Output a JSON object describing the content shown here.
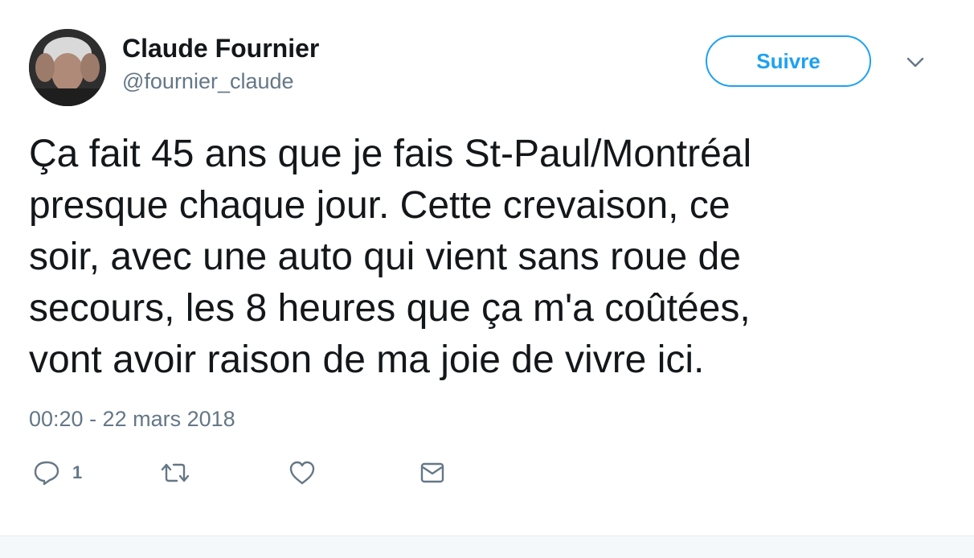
{
  "author": {
    "display_name": "Claude Fournier",
    "handle": "@fournier_claude",
    "avatar_icon": "user-photo-avatar"
  },
  "header": {
    "follow_label": "Suivre",
    "caret_icon": "chevron-down-icon"
  },
  "tweet": {
    "lines": [
      "Ça fait 45 ans que je fais St-Paul/Montréal",
      "presque chaque jour. Cette crevaison, ce",
      "soir, avec une auto qui vient sans roue de",
      "secours, les 8 heures que ça m'a coûtées,",
      "vont avoir raison de ma joie de vivre ici."
    ],
    "timestamp": "00:20 - 22 mars 2018"
  },
  "actions": {
    "reply_icon": "reply-icon",
    "reply_count": "1",
    "retweet_icon": "retweet-icon",
    "like_icon": "heart-icon",
    "dm_icon": "envelope-icon"
  },
  "colors": {
    "accent": "#1da1f2",
    "text": "#14171a",
    "muted": "#657786",
    "footer_bg": "#f5f8fa"
  }
}
